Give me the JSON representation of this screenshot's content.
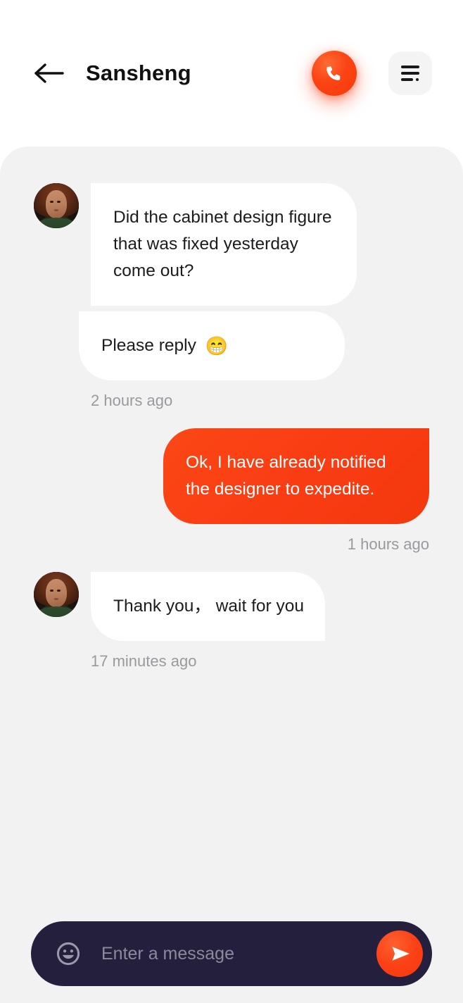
{
  "header": {
    "back_icon": "arrow-left-icon",
    "title": "Sansheng",
    "call_icon": "phone-icon",
    "menu_icon": "menu-list-icon"
  },
  "conversation": {
    "contact_avatar": "contact-avatar-photo",
    "messages": [
      {
        "id": "m1",
        "direction": "incoming",
        "text": "Did the cabinet design figure that was fixed yesterday come out?"
      },
      {
        "id": "m2",
        "direction": "incoming",
        "text": "Please reply ",
        "emoji": "😁",
        "timestamp": "2 hours ago"
      },
      {
        "id": "m3",
        "direction": "outgoing",
        "text": "Ok, I have already notified the designer to expedite.",
        "timestamp": "1 hours ago"
      },
      {
        "id": "m4",
        "direction": "incoming",
        "text": "Thank you， wait for you",
        "timestamp": "17 minutes ago"
      }
    ]
  },
  "composer": {
    "emoji_icon": "smiley-face-icon",
    "placeholder": "Enter a message",
    "value": "",
    "send_icon": "send-paper-plane-icon"
  },
  "colors": {
    "accent": "#f93c13",
    "panel_bg": "#f2f2f2",
    "page_bg": "#ffffff",
    "composer_bg": "#241f3c",
    "bubble_in_bg": "#ffffff",
    "text_primary": "#1c1c20",
    "text_muted": "#9a9a9e",
    "placeholder": "#8b8a9c"
  }
}
